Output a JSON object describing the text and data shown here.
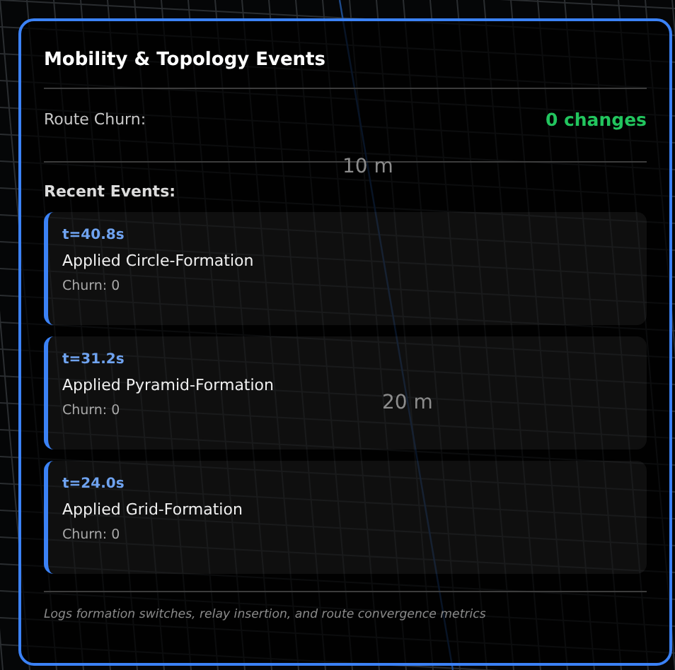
{
  "scene": {
    "labels": [
      "10 m",
      "20 m"
    ]
  },
  "panel": {
    "title": "Mobility & Topology Events",
    "metric": {
      "label": "Route Churn:",
      "value": "0 changes"
    },
    "events_heading": "Recent Events:",
    "events": [
      {
        "time": "t=40.8s",
        "description": "Applied Circle-Formation",
        "churn": "Churn: 0"
      },
      {
        "time": "t=31.2s",
        "description": "Applied Pyramid-Formation",
        "churn": "Churn: 0"
      },
      {
        "time": "t=24.0s",
        "description": "Applied Grid-Formation",
        "churn": "Churn: 0"
      }
    ],
    "footer": "Logs formation switches, relay insertion, and route convergence metrics"
  }
}
